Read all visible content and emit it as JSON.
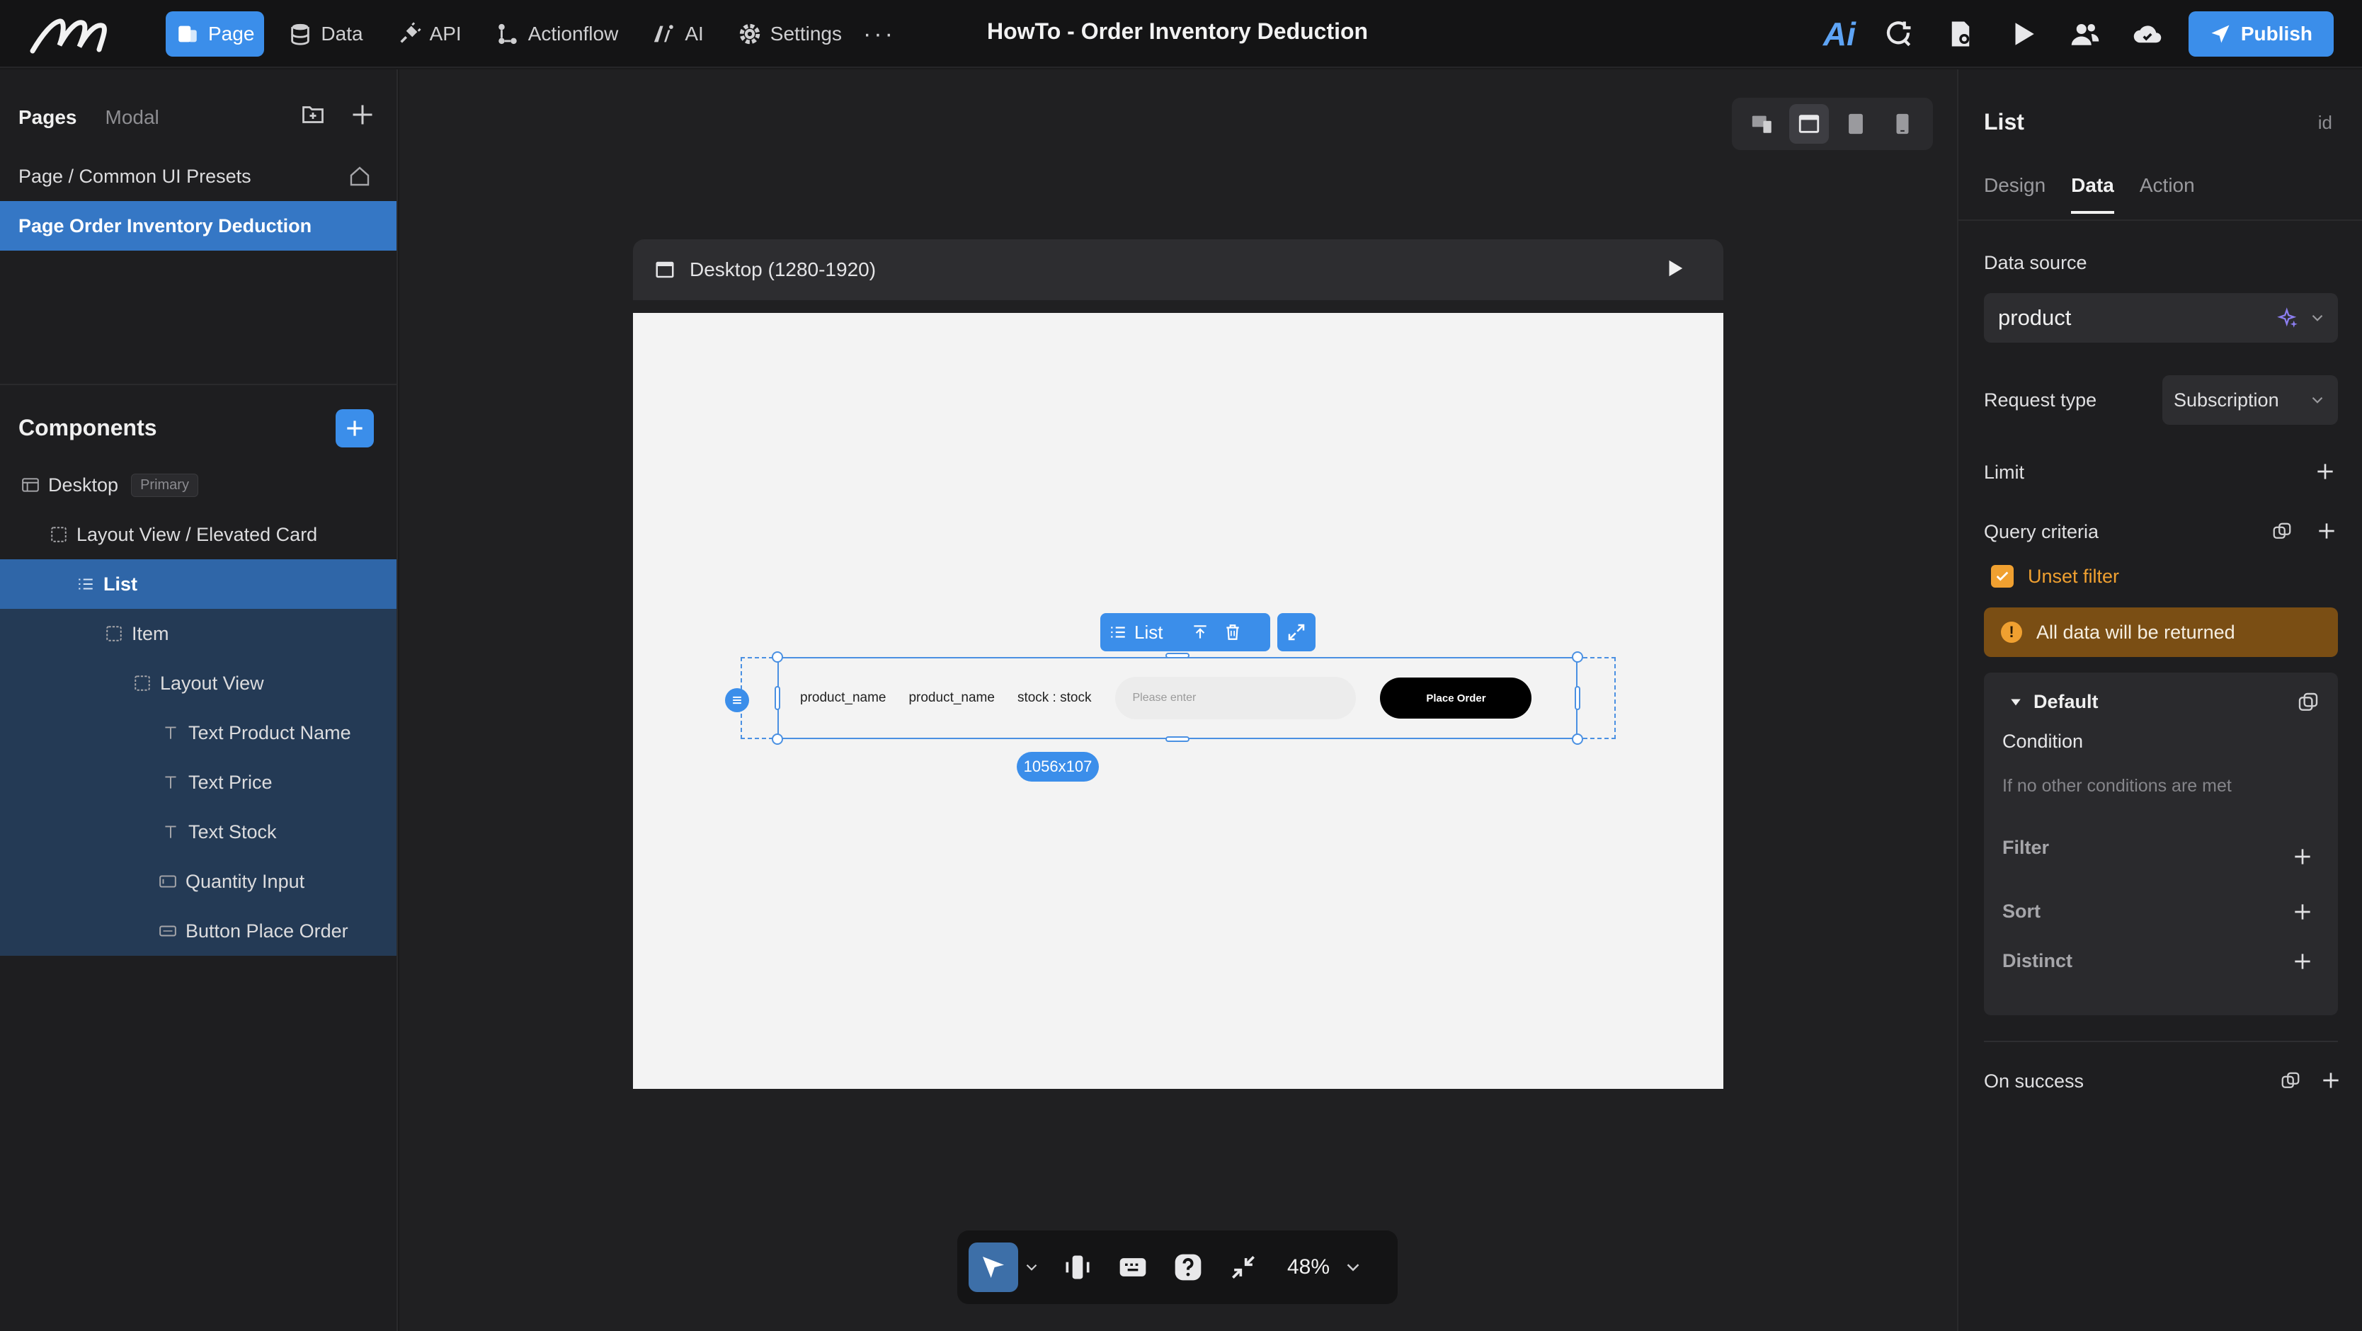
{
  "topbar": {
    "nav": [
      {
        "label": "Page",
        "icon": "page-icon",
        "active": true
      },
      {
        "label": "Data",
        "icon": "database-icon"
      },
      {
        "label": "API",
        "icon": "plug-icon"
      },
      {
        "label": "Actionflow",
        "icon": "flow-icon"
      },
      {
        "label": "AI",
        "icon": "ai-icon"
      },
      {
        "label": "Settings",
        "icon": "gear-icon"
      }
    ],
    "more": "···",
    "title": "HowTo - Order Inventory Deduction",
    "ai_label": "Ai",
    "publish": "Publish",
    "accent": "#3b8eea"
  },
  "left": {
    "pages_tab": "Pages",
    "modal_tab": "Modal",
    "pages": [
      {
        "label": "Page / Common UI Presets"
      },
      {
        "label": "Page Order Inventory Deduction"
      }
    ],
    "components_title": "Components",
    "tree": [
      {
        "label": "Desktop",
        "badge": "Primary"
      },
      {
        "label": "Layout View / Elevated Card"
      },
      {
        "label": "List"
      },
      {
        "label": "Item"
      },
      {
        "label": "Layout View"
      },
      {
        "label": "Text Product Name"
      },
      {
        "label": "Text Price"
      },
      {
        "label": "Text Stock"
      },
      {
        "label": "Quantity Input"
      },
      {
        "label": "Button Place Order"
      }
    ]
  },
  "canvas": {
    "frame_label": "Desktop (1280-1920)",
    "list_item": {
      "name": "product_name",
      "price": "product_name",
      "stock": "stock : stock",
      "input_placeholder": "Please enter",
      "button": "Place Order"
    },
    "selection_label": "List",
    "size": "1056x107",
    "zoom": "48%"
  },
  "right": {
    "title": "List",
    "id_label": "id",
    "tabs": [
      "Design",
      "Data",
      "Action"
    ],
    "data_source_label": "Data source",
    "data_source": "product",
    "request_type_label": "Request type",
    "request_type": "Subscription",
    "limit_label": "Limit",
    "query_label": "Query criteria",
    "unset_filter": "Unset filter",
    "warning": "All data will be returned",
    "warning_color": "#7a4e14",
    "default_label": "Default",
    "condition_label": "Condition",
    "condition_sub": "If no other conditions are met",
    "filter_label": "Filter",
    "sort_label": "Sort",
    "distinct_label": "Distinct",
    "on_success_label": "On success"
  }
}
